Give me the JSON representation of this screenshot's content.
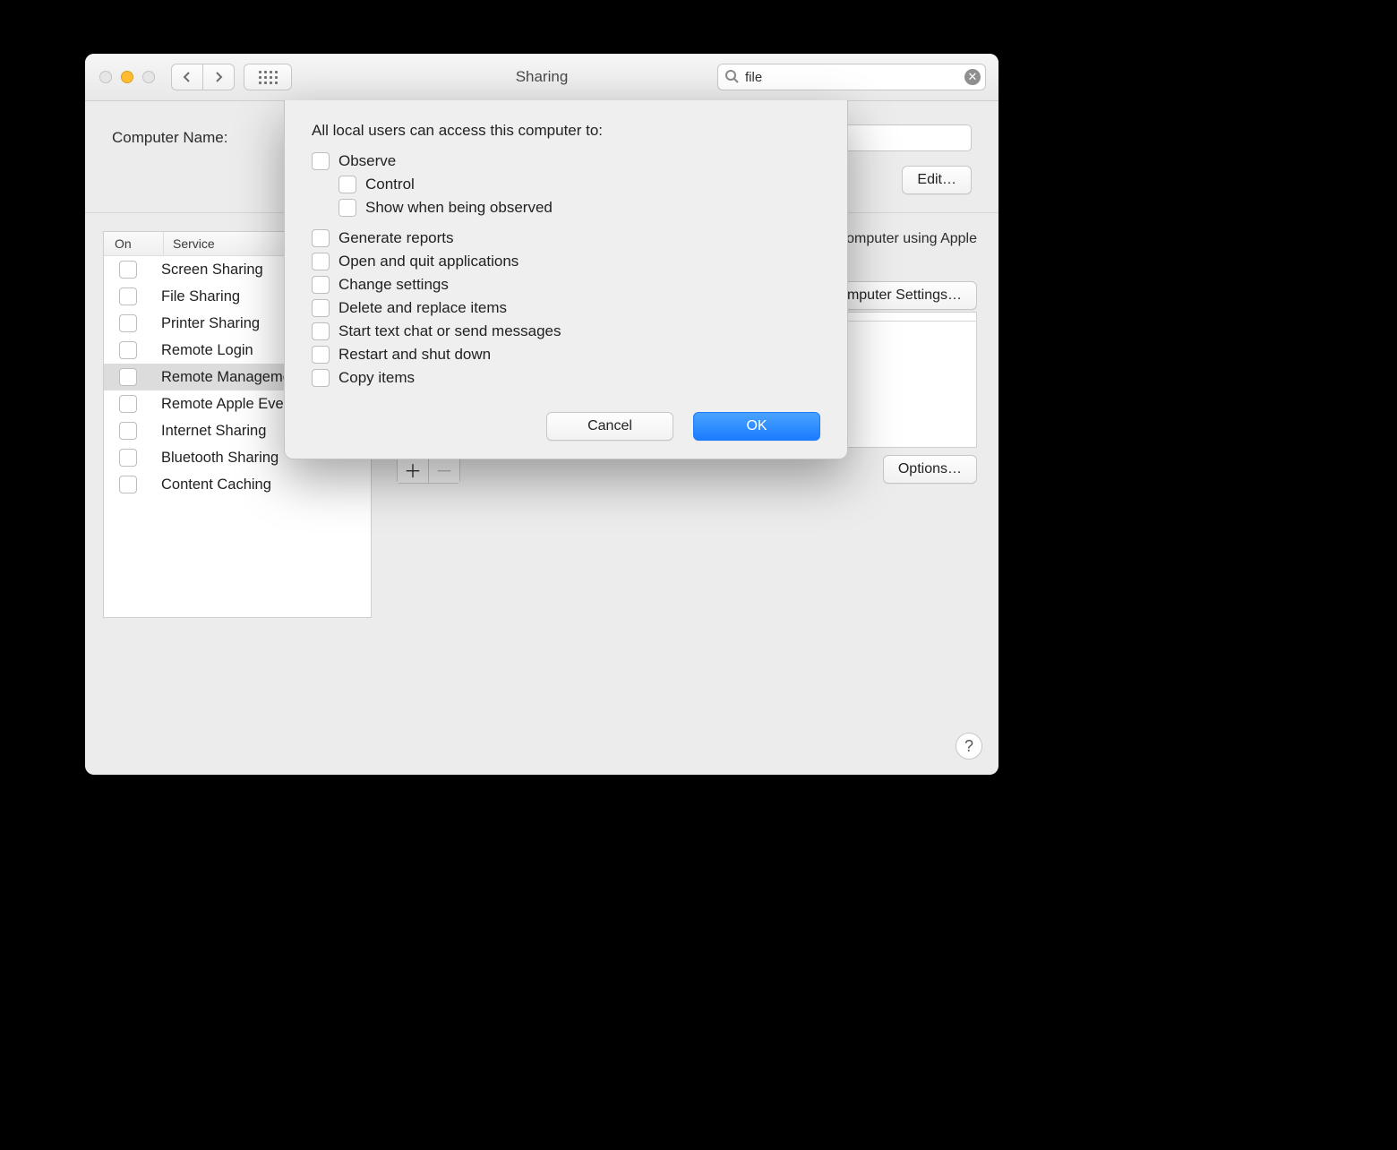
{
  "window": {
    "title": "Sharing"
  },
  "toolbar": {
    "search_value": "file"
  },
  "top": {
    "computer_name_label": "Computer Name:",
    "edit_label": "Edit…"
  },
  "services": {
    "col_on": "On",
    "col_service": "Service",
    "items": [
      {
        "label": "Screen Sharing",
        "on": false,
        "selected": false
      },
      {
        "label": "File Sharing",
        "on": false,
        "selected": false
      },
      {
        "label": "Printer Sharing",
        "on": false,
        "selected": false
      },
      {
        "label": "Remote Login",
        "on": false,
        "selected": false
      },
      {
        "label": "Remote Management",
        "on": false,
        "selected": true
      },
      {
        "label": "Remote Apple Events",
        "on": false,
        "selected": false
      },
      {
        "label": "Internet Sharing",
        "on": false,
        "selected": false
      },
      {
        "label": "Bluetooth Sharing",
        "on": false,
        "selected": false
      },
      {
        "label": "Content Caching",
        "on": false,
        "selected": false
      }
    ]
  },
  "detail": {
    "desc_fragment": "s computer using Apple",
    "computer_settings_label": "Computer Settings…",
    "options_label": "Options…"
  },
  "dialog": {
    "lead": "All local users can access this computer to:",
    "options": [
      {
        "label": "Observe",
        "indent": 0
      },
      {
        "label": "Control",
        "indent": 1
      },
      {
        "label": "Show when being observed",
        "indent": 1
      }
    ],
    "options2": [
      {
        "label": "Generate reports"
      },
      {
        "label": "Open and quit applications"
      },
      {
        "label": "Change settings"
      },
      {
        "label": "Delete and replace items"
      },
      {
        "label": "Start text chat or send messages"
      },
      {
        "label": "Restart and shut down"
      },
      {
        "label": "Copy items"
      }
    ],
    "cancel_label": "Cancel",
    "ok_label": "OK"
  },
  "help_label": "?"
}
